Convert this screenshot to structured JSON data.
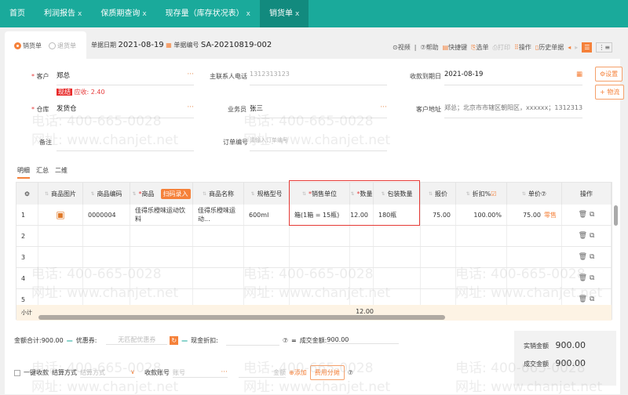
{
  "tabs": [
    {
      "label": "首页",
      "closable": false
    },
    {
      "label": "利润报告",
      "closable": true
    },
    {
      "label": "保质期查询",
      "closable": true
    },
    {
      "label": "现存量（库存状况表）",
      "closable": true
    },
    {
      "label": "销货单",
      "closable": true,
      "active": true
    }
  ],
  "close_glyph": "x",
  "doc_type": {
    "sale": "销货单",
    "return": "退货单"
  },
  "doc_date": {
    "label": "单据日期",
    "value": "2021-08-19"
  },
  "doc_no": {
    "label": "单据编号",
    "value": "SA-20210819-002"
  },
  "toolbar": {
    "video": "视频",
    "help": "帮助",
    "shortcut": "快捷键",
    "select": "选单",
    "print": "打印",
    "operate": "操作",
    "history": "历史单据"
  },
  "side_buttons": {
    "settings": "设置",
    "logistics": "+ 物流"
  },
  "form": {
    "customer": {
      "label": "客户",
      "value": "郑总"
    },
    "settle_badge": "现结",
    "receivable": "应收: 2.40",
    "contact_phone": {
      "label": "主联系人电话",
      "value": "1312313123"
    },
    "due_date": {
      "label": "收款到期日",
      "value": "2021-08-19"
    },
    "warehouse": {
      "label": "仓库",
      "value": "发货仓"
    },
    "salesman": {
      "label": "业务员",
      "value": "张三"
    },
    "address": {
      "label": "客户地址",
      "value": "郑总；北京市市辖区朝阳区，xxxxxx；1312313123"
    },
    "remark": {
      "label": "备注",
      "value": ""
    },
    "order_no": {
      "label": "订单编号",
      "placeholder": "请输入订单编号"
    }
  },
  "subtabs": [
    "明细",
    "汇总",
    "二维"
  ],
  "table": {
    "headers": [
      "商品图片",
      "商品编码",
      "商品",
      "商品名称",
      "规格型号",
      "销售单位",
      "数量",
      "包装数量",
      "报价",
      "折扣%",
      "单价⑦",
      "操作"
    ],
    "scan_label": "扫码录入",
    "rows": [
      {
        "no": "1",
        "code": "0000004",
        "product": "佳得乐橙味运动饮料",
        "name": "佳得乐橙味运动...",
        "spec": "600ml",
        "unit": "箱(1箱 = 15瓶)",
        "qty": "12.00",
        "pack_qty": "180瓶",
        "quote": "75.00",
        "discount": "100.00%",
        "price": "75.00",
        "price_tag": "零售"
      },
      {
        "no": "2"
      },
      {
        "no": "3"
      },
      {
        "no": "4"
      },
      {
        "no": "5"
      }
    ],
    "subtotal_label": "小计",
    "subtotal_qty": "12.00"
  },
  "summary": {
    "total_label": "金额合计:",
    "total": "900.00",
    "coupon_label": "优惠券:",
    "coupon_placeholder": "无匹配优惠券",
    "cash_discount_label": "现金折扣:",
    "deal_label": "成交金额:",
    "deal": "900.00",
    "actual_label": "实销金额",
    "actual": "900.00",
    "deal2_label": "成交金额",
    "deal2": "900.00"
  },
  "payment": {
    "one_click": "一键收款",
    "method_label": "结算方式",
    "method_placeholder": "结算方式",
    "account_label": "收款账号",
    "account_placeholder": "账号",
    "amount_placeholder": "金额",
    "add": "添加",
    "allocate": "费用分摊"
  },
  "watermark": {
    "phone": "电话: 400-665-0028",
    "site": "网址: www.chanjet.net"
  },
  "colors": {
    "teal": "#1aaa9b",
    "orange": "#f5813a",
    "red": "#e63b3b"
  }
}
